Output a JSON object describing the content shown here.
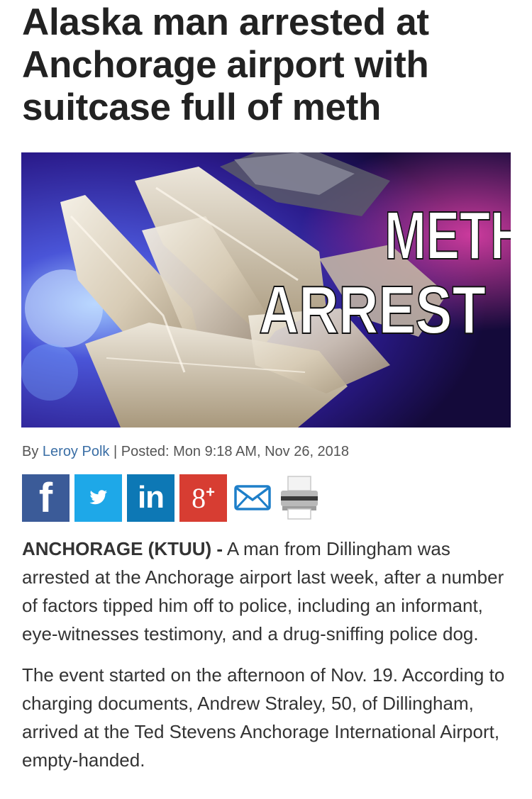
{
  "article": {
    "headline": "Alaska man arrested at Anchorage airport with suitcase full of meth",
    "hero_image": {
      "overlay_line1": "METH",
      "overlay_line2": "ARREST"
    },
    "byline": {
      "prefix": "By",
      "author": "Leroy Polk",
      "separator": "|",
      "posted": "Posted: Mon 9:18 AM, Nov 26, 2018"
    },
    "share": {
      "facebook_glyph": "f",
      "linkedin_glyph": "in",
      "googleplus_glyph": "8",
      "googleplus_sup": "+"
    },
    "paragraphs": [
      {
        "dateline": "ANCHORAGE (KTUU) -",
        "text": " A man from Dillingham was arrested at the Anchorage airport last week, after a number of factors tipped him off to police, including an informant, eye-witnesses testimony, and a drug-sniffing police dog."
      },
      {
        "text": "The event started on the afternoon of Nov. 19. According to charging documents, Andrew Straley, 50, of Dillingham, arrived at the Ted Stevens Anchorage International Airport, empty-handed."
      }
    ]
  },
  "colors": {
    "facebook": "#3b5b98",
    "twitter": "#1ea8e8",
    "linkedin": "#0d78b5",
    "googleplus": "#d73d32",
    "author_link": "#3a6ea5"
  },
  "icons": [
    "facebook-icon",
    "twitter-icon",
    "linkedin-icon",
    "google-plus-icon",
    "email-icon",
    "print-icon"
  ]
}
